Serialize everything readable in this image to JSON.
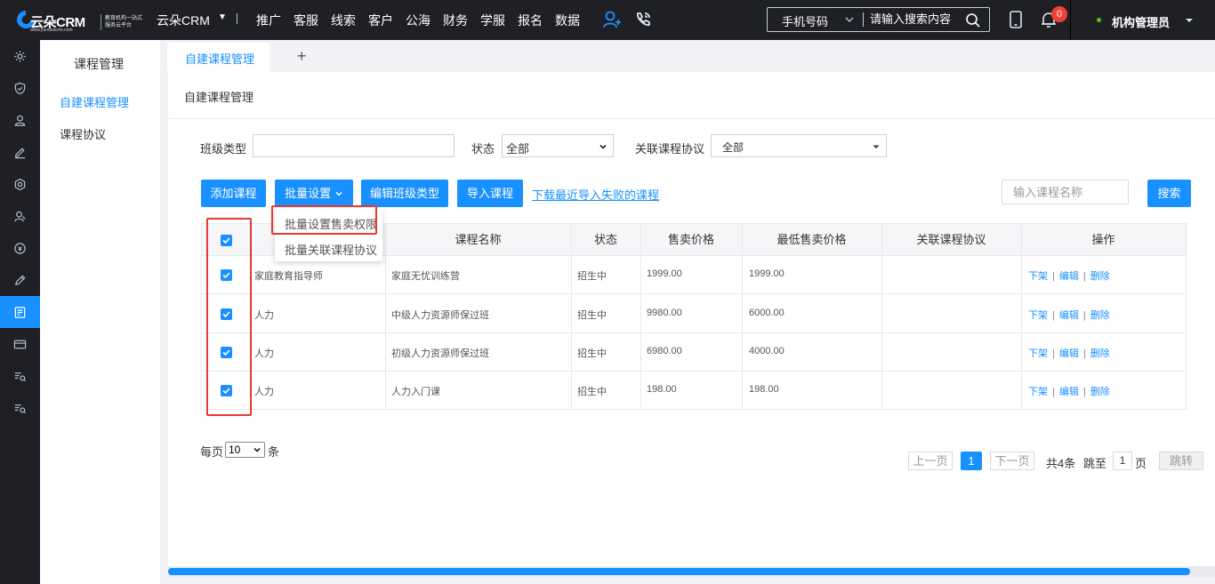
{
  "topbar": {
    "logo_text": "云朵CRM",
    "logo_url": "www.yunduocrm.com",
    "logo_slogan": "教育机构一站式服务云平台",
    "brand_name": "云朵CRM",
    "nav": [
      "推广",
      "客服",
      "线索",
      "客户",
      "公海",
      "财务",
      "学服",
      "报名",
      "数据"
    ],
    "search_type": "手机号码",
    "search_placeholder": "请输入搜索内容",
    "notification_count": "0",
    "user_name": "机构管理员"
  },
  "submenu": {
    "title": "课程管理",
    "items": [
      "自建课程管理",
      "课程协议"
    ]
  },
  "tabs": {
    "active": "自建课程管理",
    "add": "+"
  },
  "panel": {
    "title": "自建课程管理",
    "filters": {
      "class_type_label": "班级类型",
      "class_type_value": "",
      "status_label": "状态",
      "status_value": "全部",
      "protocol_label": "关联课程协议",
      "protocol_value": "全部"
    },
    "toolbar": {
      "add": "添加课程",
      "batch": "批量设置",
      "edit_class_type": "编辑班级类型",
      "import": "导入课程",
      "download_failed": "下载最近导入失败的课程",
      "name_placeholder": "输入课程名称",
      "search": "搜索"
    },
    "dropdown": [
      "批量设置售卖权限",
      "批量关联课程协议"
    ],
    "table": {
      "columns": [
        "",
        "",
        "课程名称",
        "状态",
        "售卖价格",
        "最低售卖价格",
        "关联课程协议",
        "操作"
      ],
      "rows": [
        {
          "type": "家庭教育指导师",
          "name": "家庭无忧训练营",
          "status": "招生中",
          "price": "1999.00",
          "min_price": "1999.00",
          "protocol": ""
        },
        {
          "type": "人力",
          "name": "中级人力资源师保过班",
          "status": "招生中",
          "price": "9980.00",
          "min_price": "6000.00",
          "protocol": ""
        },
        {
          "type": "人力",
          "name": "初级人力资源师保过班",
          "status": "招生中",
          "price": "6980.00",
          "min_price": "4000.00",
          "protocol": ""
        },
        {
          "type": "人力",
          "name": "人力入门课",
          "status": "招生中",
          "price": "198.00",
          "min_price": "198.00",
          "protocol": ""
        }
      ],
      "ops": {
        "offline": "下架",
        "edit": "编辑",
        "delete": "删除"
      }
    },
    "pagination": {
      "per_page_label": "每页",
      "per_page_value": "10",
      "per_page_unit": "条",
      "prev": "上一页",
      "current": "1",
      "next": "下一页",
      "total": "共4条",
      "jump_label": "跳至",
      "jump_value": "1",
      "page_unit": "页",
      "go": "跳转"
    }
  },
  "colors": {
    "accent": "#1890ff",
    "topbar": "#1f2026",
    "highlight": "#e53935"
  }
}
